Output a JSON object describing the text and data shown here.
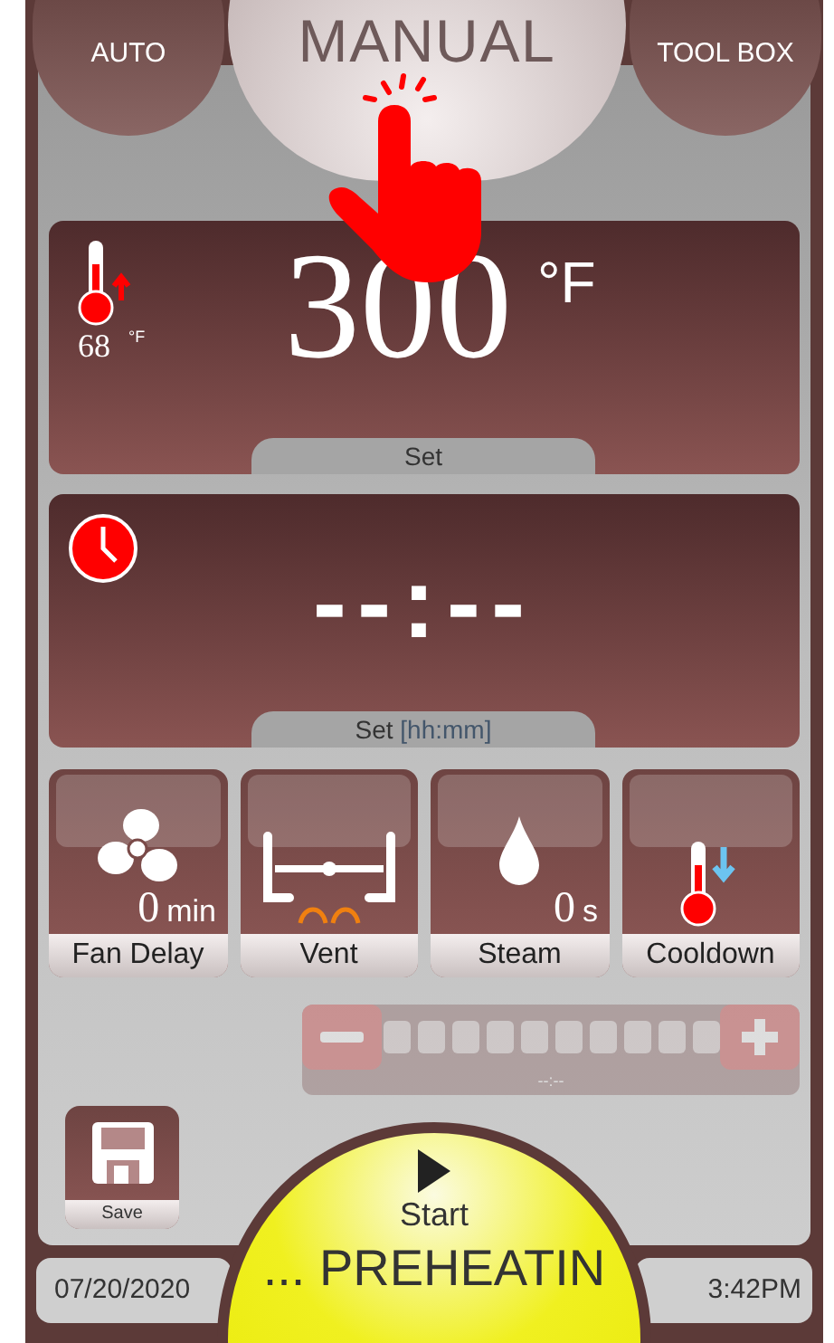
{
  "tabs": [
    {
      "label": "AUTO",
      "selected": false
    },
    {
      "label": "MANUAL",
      "selected": true
    },
    {
      "label": "TOOL BOX",
      "selected": false
    }
  ],
  "temperature": {
    "current": "68",
    "current_unit": "°F",
    "set_value": "300",
    "set_unit": "°F",
    "label": "Set"
  },
  "timer": {
    "value": "--:--",
    "label": "Set",
    "format_hint": "[hh:mm]"
  },
  "options": [
    {
      "kind": "fan",
      "value": "0",
      "unit": "min",
      "label": "Fan Delay"
    },
    {
      "kind": "vent",
      "label": "Vent"
    },
    {
      "kind": "steam",
      "value": "0",
      "unit": "s",
      "label": "Steam"
    },
    {
      "kind": "cooldown",
      "label": "Cooldown"
    }
  ],
  "stepper": {
    "disabled": true,
    "reading": "--:--"
  },
  "save_button": {
    "label": "Save"
  },
  "start_button": {
    "label": "Start",
    "status": "... PREHEATIN"
  },
  "status_bar": {
    "date": "07/20/2020",
    "time": "3:42PM"
  }
}
